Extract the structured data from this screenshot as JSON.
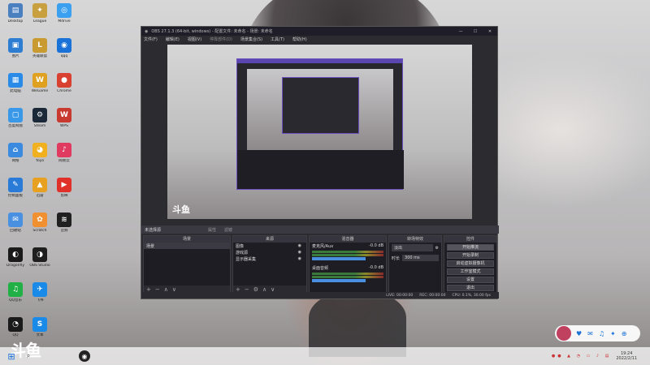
{
  "desktop_icons": [
    {
      "label": "Desktop",
      "color": "#4a7fc0",
      "glyph": "▤"
    },
    {
      "label": "League",
      "color": "#c8a040",
      "glyph": "✦"
    },
    {
      "label": "Mdrive",
      "color": "#3ca0f0",
      "glyph": "◎"
    },
    {
      "label": "图片",
      "color": "#2d7dd2",
      "glyph": "▣"
    },
    {
      "label": "英雄联盟",
      "color": "#c89a30",
      "glyph": "L"
    },
    {
      "label": "qqq",
      "color": "#1a72d8",
      "glyph": "◉"
    },
    {
      "label": "此电脑",
      "color": "#2a8ae8",
      "glyph": "▦"
    },
    {
      "label": "WeGame",
      "color": "#e0a020",
      "glyph": "W"
    },
    {
      "label": "Chrome",
      "color": "#d84030",
      "glyph": "●"
    },
    {
      "label": "百度网盘",
      "color": "#3a98e8",
      "glyph": "▢"
    },
    {
      "label": "Steam",
      "color": "#1b2838",
      "glyph": "⚙"
    },
    {
      "label": "WPS",
      "color": "#c83a30",
      "glyph": "W"
    },
    {
      "label": "网络",
      "color": "#3a8ae0",
      "glyph": "⌂"
    },
    {
      "label": "Yoyo",
      "color": "#f0b020",
      "glyph": "◕"
    },
    {
      "label": "网易云",
      "color": "#e03a60",
      "glyph": "♪"
    },
    {
      "label": "控制面板",
      "color": "#2a7ad8",
      "glyph": "✎"
    },
    {
      "label": "迅雷",
      "color": "#e8a020",
      "glyph": "▲"
    },
    {
      "label": "剪映",
      "color": "#e0302a",
      "glyph": "▶"
    },
    {
      "label": "回收站",
      "color": "#4a90e0",
      "glyph": "✉"
    },
    {
      "label": "Scratch",
      "color": "#f09030",
      "glyph": "✿"
    },
    {
      "label": "音频",
      "color": "#202020",
      "glyph": "≋"
    },
    {
      "label": "Dragonfly",
      "color": "#1a1a1a",
      "glyph": "◐"
    },
    {
      "label": "OBS Studio",
      "color": "#1e1e1e",
      "glyph": "◑"
    },
    {
      "label": "",
      "color": "",
      "glyph": ""
    },
    {
      "label": "QQ音乐",
      "color": "#21b046",
      "glyph": "♫"
    },
    {
      "label": "飞书",
      "color": "#1a8ae8",
      "glyph": "✈"
    },
    {
      "label": "",
      "color": "",
      "glyph": ""
    },
    {
      "label": "QQ",
      "color": "#1a1a1a",
      "glyph": "◔"
    },
    {
      "label": "文本",
      "color": "#1a8ae8",
      "glyph": "S"
    },
    {
      "label": "",
      "color": "",
      "glyph": ""
    }
  ],
  "obs": {
    "title": "OBS 27.1.3 (64-bit, windows) - 配置文件: 未命名 - 场景: 未命名",
    "win_min": "—",
    "win_max": "☐",
    "win_close": "✕",
    "menu": [
      "文件(F)",
      "编辑(E)",
      "视图(V)",
      "停靠部件(D)",
      "场景集合(S)",
      "工具(T)",
      "帮助(H)"
    ],
    "tabs": [
      "未选择源",
      "属性",
      "滤镜"
    ],
    "scenes": {
      "title": "场景",
      "items": [
        "场景"
      ]
    },
    "sources": {
      "title": "来源",
      "items": [
        "图像",
        "游戏源",
        "显示器采集"
      ]
    },
    "mixer": {
      "title": "混音器",
      "channels": [
        {
          "name": "麦克风/Aux",
          "db": "-0.0 dB"
        },
        {
          "name": "桌面音频",
          "db": "-0.0 dB"
        }
      ]
    },
    "transitions": {
      "title": "转场特效",
      "type": "淡出",
      "duration_label": "时长",
      "duration": "300 ms"
    },
    "controls": {
      "title": "控件",
      "buttons": [
        "开始推流",
        "开始录制",
        "启动虚拟摄像机",
        "工作室模式",
        "设置",
        "退出"
      ]
    },
    "status": {
      "live": "LIVE: 00:00:00",
      "rec": "REC: 00:00:00",
      "cpu": "CPU: 0.1%, 30.00 fps"
    }
  },
  "taskbar": {
    "start": "⊞",
    "search": "⌕",
    "time": "19:24",
    "date": "2022/2/11"
  },
  "watermark": "斗鱼",
  "notif_icons": [
    "♥",
    "✉",
    "♫",
    "✦",
    "⊕"
  ]
}
